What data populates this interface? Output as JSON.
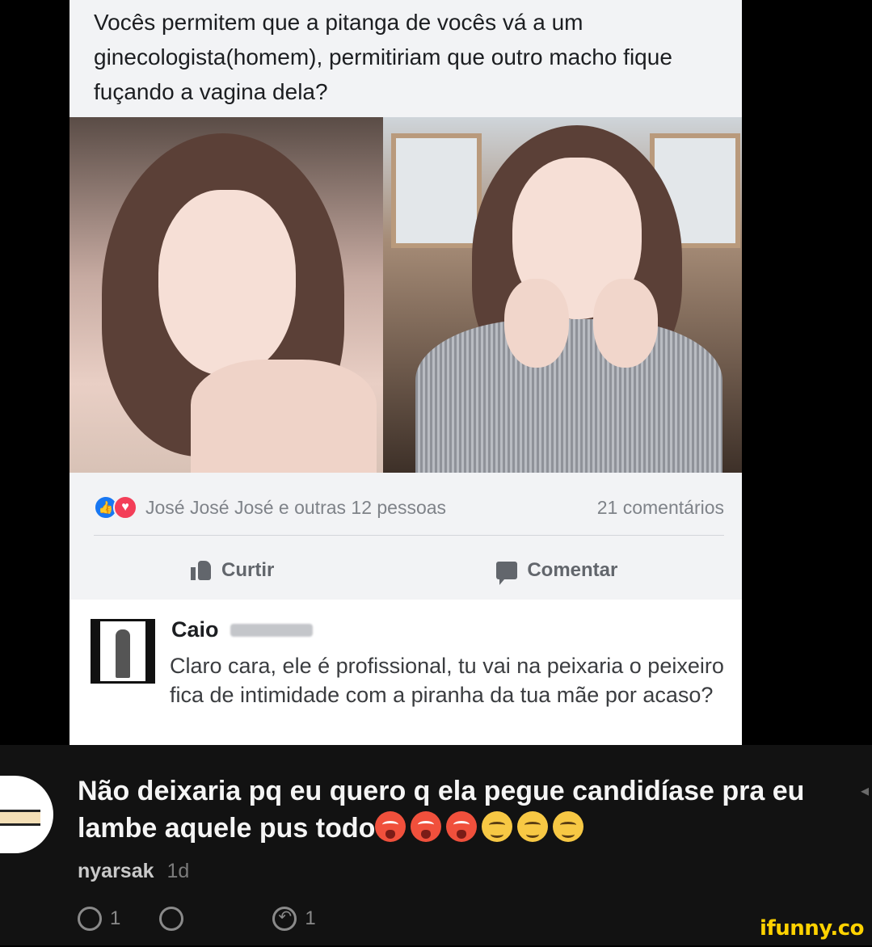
{
  "post": {
    "question": "Vocês permitem que a pitanga de vocês vá a um ginecologista(homem), permitiriam que outro macho fique fuçando a vagina dela?",
    "reactions_text": "José José José e outras 12 pessoas",
    "comments_count": "21 comentários",
    "like_label": "Curtir",
    "comment_label": "Comentar"
  },
  "fb_comment": {
    "author": "Caio",
    "text": "Claro cara, ele é profissional, tu vai na peixaria o peixeiro fica de intimidade com a piranha da tua mãe por acaso?"
  },
  "ifunny_comment": {
    "text": "Não deixaria pq eu quero q ela pegue candidíase pra eu lambe aquele pus todo",
    "emojis": [
      "hot-face",
      "hot-face",
      "hot-face",
      "drooling-face",
      "drooling-face",
      "drooling-face"
    ],
    "username": "nyarsak",
    "time": "1d",
    "smile_count": "1",
    "reply_count": "1"
  },
  "watermark": "ifunny.co",
  "colors": {
    "fb_like_blue": "#1877f2",
    "fb_love_red": "#f33e58",
    "ifunny_yellow": "#ffd200",
    "dark_bg": "#121212"
  }
}
